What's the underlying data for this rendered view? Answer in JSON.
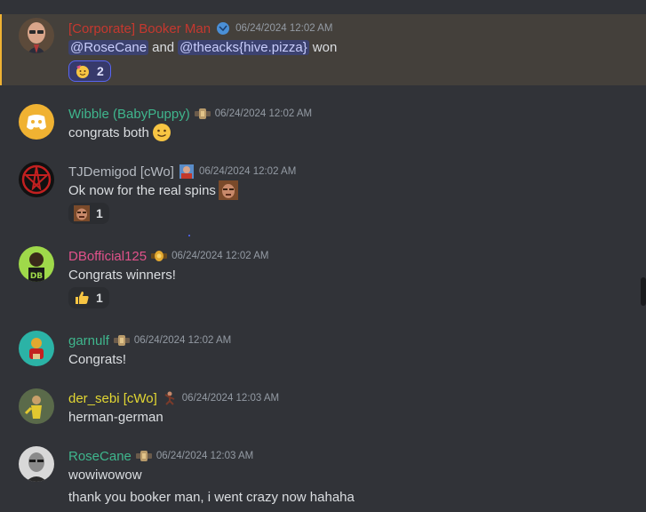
{
  "messages": [
    {
      "username": "[Corporate] Booker Man",
      "username_color": "#c6382f",
      "role_icon": "globe-badge-icon",
      "timestamp": "06/24/2024 12:02 AM",
      "content": {
        "mention1": "@RoseCane",
        "connector": "and",
        "mention2": "@theacks{hive.pizza}",
        "suffix": "won"
      },
      "reaction": {
        "emoji": "partying-face-icon",
        "count": "2"
      }
    },
    {
      "username": "Wibble (BabyPuppy)",
      "username_color": "#3fb68d",
      "role_icon": "championship-belt-icon",
      "timestamp": "06/24/2024 12:02 AM",
      "content": "congrats both",
      "content_emoji": "slightly-smiling-face-icon"
    },
    {
      "username": "TJDemigod [cWo]",
      "username_color": "#b5bac1",
      "role_icon": "wrestler-portrait-icon",
      "timestamp": "06/24/2024 12:02 AM",
      "content": "Ok now for the real spins",
      "content_emoji": "face-custom-emoji-icon",
      "reaction": {
        "emoji": "face-custom-emoji-icon",
        "count": "1"
      }
    },
    {
      "username": "DBofficial125",
      "username_color": "#e0528a",
      "role_icon": "gold-belt-icon",
      "timestamp": "06/24/2024 12:02 AM",
      "content": "Congrats winners!",
      "reaction": {
        "emoji": "thumbs-up-icon",
        "count": "1"
      }
    },
    {
      "username": "garnulf",
      "username_color": "#3fb68d",
      "role_icon": "championship-belt-icon",
      "timestamp": "06/24/2024 12:02 AM",
      "content": "Congrats!"
    },
    {
      "username": "der_sebi [cWo]",
      "username_color": "#e2d733",
      "role_icon": "dancing-figure-icon",
      "timestamp": "06/24/2024 12:03 AM",
      "content": "herman-german"
    },
    {
      "username": "RoseCane",
      "username_color": "#3fb68d",
      "role_icon": "championship-belt-icon",
      "timestamp": "06/24/2024 12:03 AM",
      "content": "wowiwowow",
      "content2": "thank you booker man, i went crazy now hahaha"
    }
  ]
}
